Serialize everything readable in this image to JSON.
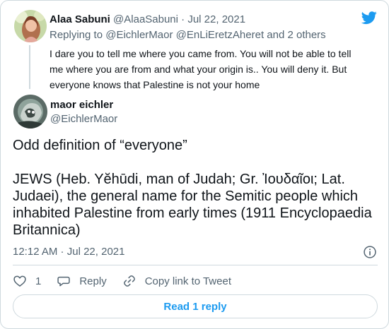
{
  "colors": {
    "accent": "#1d9bf0",
    "text": "#0f1419",
    "muted": "#536471",
    "border": "#cfd9de"
  },
  "parent_tweet": {
    "name": "Alaa Sabuni",
    "handle": "@AlaaSabuni",
    "separator": " · ",
    "date": "Jul 22, 2021",
    "replying_prefix": "Replying to ",
    "replying_user_1": "@EichlerMaor",
    "replying_user_2": "@EnLiEretzAheret",
    "replying_suffix": " and 2 others",
    "text_lines": [
      "I dare you to tell me where you came from. You will not be able to tell",
      "me where you are from and what your origin is.. You will deny it.  But",
      "everyone knows that Palestine is not your home"
    ]
  },
  "main_tweet": {
    "name": "maor eichler",
    "handle": "@EichlerMaor",
    "text_line_1": "Odd definition of “everyone”",
    "text_lines": [
      "JEWS (Heb. Yĕhūdi, man of Judah; Gr. Ἰουδαῖοι; Lat.",
      "Judaei), the general name for the Semitic people which",
      "inhabited Palestine from early times (1911 Encyclopaedia",
      "Britannica)"
    ],
    "time": "12:12 AM",
    "separator": " · ",
    "date": "Jul 22, 2021"
  },
  "actions": {
    "like_count": "1",
    "reply_label": "Reply",
    "copy_link_label": "Copy link to Tweet"
  },
  "read_replies_label": "Read 1 reply",
  "icons": {
    "brand": "twitter-bird-icon",
    "info": "info-icon",
    "like": "heart-icon",
    "reply": "speech-bubble-icon",
    "copy_link": "link-icon"
  }
}
